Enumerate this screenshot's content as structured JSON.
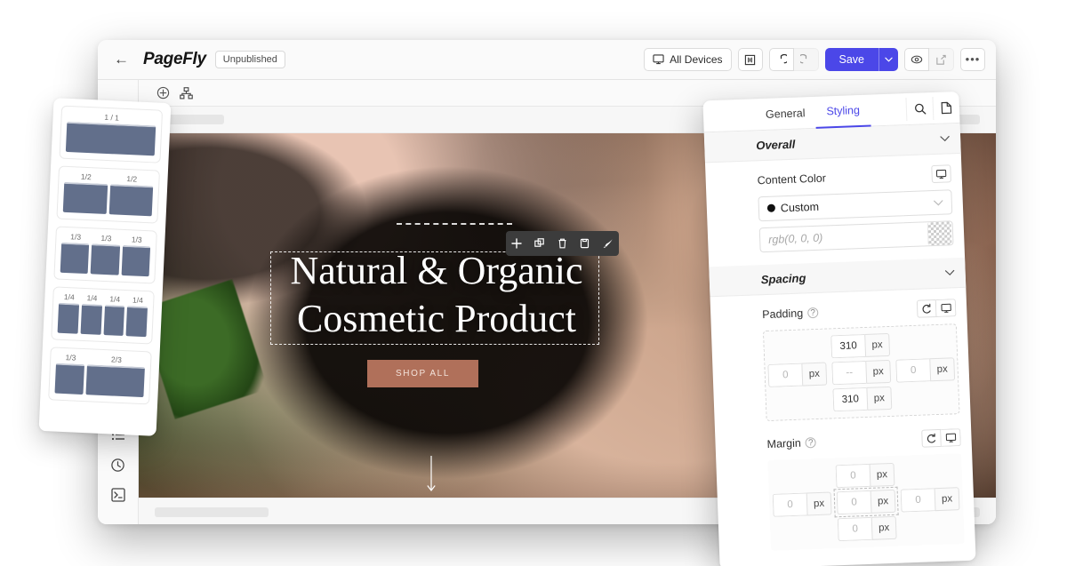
{
  "topbar": {
    "back_icon": "back-arrow-icon",
    "brand": "PageFly",
    "status_badge": "Unpublished",
    "devices_label": "All Devices",
    "devices_icon": "monitor-icon",
    "ruler_icon": "ruler-icon",
    "undo_icon": "undo-icon",
    "redo_icon": "redo-icon",
    "save_label": "Save",
    "save_caret": "⌄",
    "preview_icon": "eye-icon",
    "publish_icon": "export-icon",
    "more_icon": "more-dots-icon",
    "more_label": "•••"
  },
  "tool_rail": {
    "items": [
      {
        "name": "elements-list-icon"
      },
      {
        "name": "history-clock-icon"
      },
      {
        "name": "code-terminal-icon"
      }
    ]
  },
  "canvas_subbar": {
    "add_icon": "add-circle-icon",
    "layers_icon": "sitemap-icon"
  },
  "layout_panel": {
    "presets": [
      {
        "labels": [
          "1 / 1"
        ],
        "widths": [
          100
        ]
      },
      {
        "labels": [
          "1/2",
          "1/2"
        ],
        "widths": [
          50,
          50
        ]
      },
      {
        "labels": [
          "1/3",
          "1/3",
          "1/3"
        ],
        "widths": [
          33.33,
          33.33,
          33.33
        ]
      },
      {
        "labels": [
          "1/4",
          "1/4",
          "1/4",
          "1/4"
        ],
        "widths": [
          25,
          25,
          25,
          25
        ]
      },
      {
        "labels": [
          "1/3",
          "2/3"
        ],
        "widths": [
          33.33,
          66.66
        ]
      }
    ]
  },
  "storefront": {
    "heading_line1": "Natural & Organic",
    "heading_line2": "Cosmetic Product",
    "cta_label": "SHOP ALL",
    "cta_color": "#b0705a",
    "scroll_icon": "down-arrow-icon",
    "float_toolbar": [
      {
        "name": "move-icon",
        "glyph": "✚"
      },
      {
        "name": "duplicate-icon",
        "glyph": "❐"
      },
      {
        "name": "delete-trash-icon",
        "glyph": "Ὕ1"
      },
      {
        "name": "paste-icon",
        "glyph": "▯"
      },
      {
        "name": "edit-brush-icon",
        "glyph": "✎"
      }
    ]
  },
  "style_panel": {
    "tabs": [
      {
        "label": "General",
        "active": false
      },
      {
        "label": "Styling",
        "active": true
      }
    ],
    "search_icon": "search-icon",
    "page-icon": "page-document-icon",
    "sections": {
      "overall": {
        "title": "Overall",
        "chevron": "chevron-down-icon",
        "content_color_label": "Content Color",
        "device_icon": "monitor-icon",
        "color_mode_value": "Custom",
        "color_mode_caret": "chevron-down-icon",
        "color_value_placeholder": "rgb(0, 0, 0)",
        "swatch_icon": "checker-swatch-icon"
      },
      "spacing": {
        "title": "Spacing",
        "chevron": "chevron-down-icon",
        "padding": {
          "label": "Padding",
          "help_icon": "help-question-icon",
          "reset_icon": "reset-circle-icon",
          "device_icon": "monitor-icon",
          "top": "310",
          "left": "0",
          "center": "--",
          "right": "0",
          "bottom": "310",
          "unit": "px"
        },
        "margin": {
          "label": "Margin",
          "help_icon": "help-question-icon",
          "reset_icon": "reset-circle-icon",
          "device_icon": "monitor-icon",
          "top": "0",
          "left": "0",
          "center": "0",
          "right": "0",
          "bottom": "0",
          "unit": "px"
        }
      }
    }
  },
  "colors": {
    "accent": "#4b47e8",
    "cta": "#b0705a",
    "preset_bar": "#626f8b"
  }
}
